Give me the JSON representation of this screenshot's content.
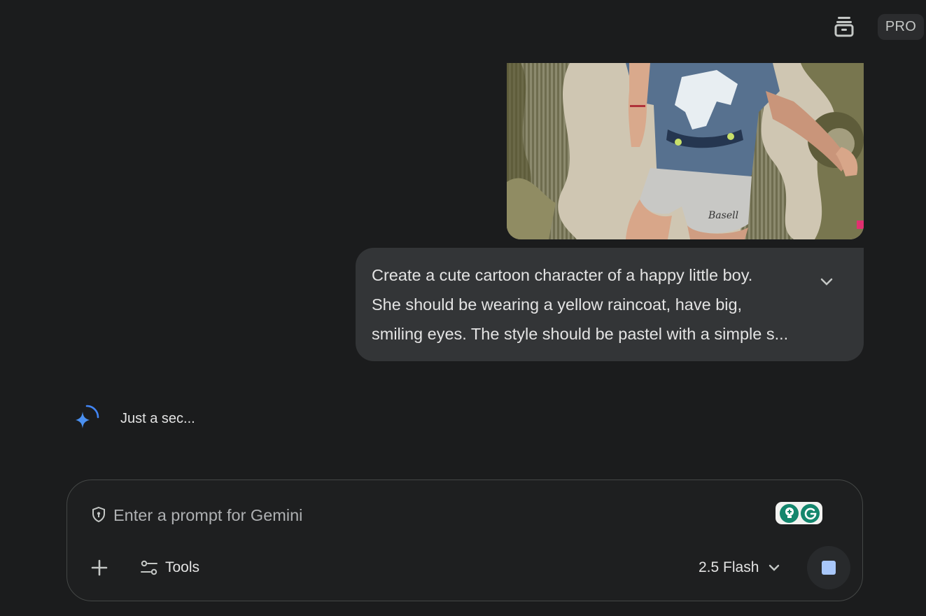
{
  "header": {
    "archive_icon": "archive-icon",
    "badge": "PRO"
  },
  "conversation": {
    "uploaded_image": {
      "kind": "photo",
      "shorts_text": "Basell"
    },
    "user_message": {
      "text": "Create a cute cartoon character of a happy little boy.\nShe should be wearing a yellow raincoat, have big,\nsmiling eyes. The style should be pastel with a simple s...",
      "expand_icon": "chevron-down-icon"
    },
    "response": {
      "status": "Just a sec...",
      "icon": "gemini-spark-icon"
    }
  },
  "prompt": {
    "placeholder": "Enter a prompt for Gemini",
    "value": "",
    "add_icon": "plus-icon",
    "tools_label": "Tools",
    "model_label": "2.5 Flash",
    "stop_icon": "stop-icon"
  },
  "colors": {
    "background": "#1b1c1d",
    "bubble": "#333537",
    "accent": "#a8c7fa",
    "spark": "#4285f4",
    "grammarly": "#14866d"
  }
}
